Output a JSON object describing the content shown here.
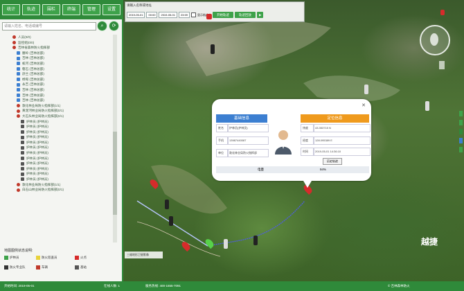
{
  "toolbar": {
    "buttons": [
      "统计",
      "轨迹",
      "围栏",
      "终端",
      "管理",
      "设置"
    ]
  },
  "left_panel": {
    "search_placeholder": "请输入姓名、电话或编号",
    "tree_items": [
      "人员(0/0)",
      "监控组(0/0)",
      "吉林省森林防火指挥部",
      "腰岭 (吉林总部)",
      "吉林 (吉林总部)",
      "蛟河 (吉林总部)",
      "磐石 (吉林总部)",
      "舒兰 (吉林总部)",
      "桦甸 (吉林总部)",
      "永吉 (吉林总部)",
      "吉林 (吉林总部)",
      "吉林 (吉林总部)",
      "吉林 (吉林总部)",
      "敦化林业局防火指挥部(1/1)",
      "黄泥河林业局防火指挥部(0/1)",
      "大石头林业局防火指挥部(0/1)",
      "护林员 (护林员)",
      "护林员 (护林员)",
      "护林员 (护林员)",
      "护林员 (护林员)",
      "护林员 (护林员)",
      "护林员 (护林员)",
      "护林员 (护林员)",
      "护林员 (护林员)",
      "护林员 (护林员)",
      "护林员 (护林员)",
      "护林员 (护林员)",
      "护林员 (护林员)",
      "敦化林业局防火指挥部(1/1)",
      "白石山林业局防火指挥部(0/1)"
    ],
    "legend_title": "地图图例状态说明:",
    "legend_items": [
      "护林员",
      "防火巡查员",
      "火点",
      "防火专业队",
      "车辆",
      "基站"
    ]
  },
  "map_controls": {
    "row1": "请输入名称或地址",
    "date_from": "2019-05-01",
    "time_from": "00:00",
    "date_to": "2019-05-01",
    "time_to": "23:59",
    "check_label": "显示轨迹点",
    "btn_query": "开始轨迹",
    "btn_replay": "轨迹回放"
  },
  "popup": {
    "left_title": "基础信息",
    "right_title": "定位信息",
    "fields_left": [
      {
        "k": "姓名",
        "v": "护林员(护林员)"
      },
      {
        "k": "手机",
        "v": "13987440087"
      },
      {
        "k": "单位",
        "v": "敦化林业局防火指挥部"
      }
    ],
    "fields_right": [
      {
        "k": "纬度",
        "v": "43.353715 N"
      },
      {
        "k": "经度",
        "v": "128.095389 E"
      },
      {
        "k": "时间",
        "v": "2019-05-01 14:36:10"
      }
    ],
    "button": "历史轨迹",
    "bottom_left": "电量",
    "bottom_right": "94%"
  },
  "map_legend_box": "三维地形卫星影像",
  "logo_text": "越捷",
  "status": {
    "left": "开始时间: 2019-05-01",
    "mid": "在线人数: 1",
    "mid2": "服务热线: 400-1655-7091",
    "right": "© 吉林森林防火"
  },
  "colors": {
    "brand": "#2f8a3a",
    "popup_left": "#3c7fd1",
    "popup_right": "#ef9a1d"
  }
}
